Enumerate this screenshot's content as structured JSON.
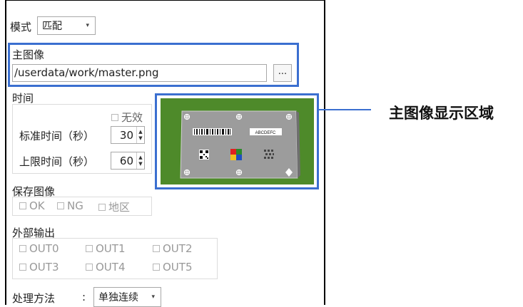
{
  "mode": {
    "label": "模式",
    "value": "匹配"
  },
  "master_image": {
    "label": "主图像",
    "path": "/userdata/work/master.png",
    "browse_label": "..."
  },
  "time": {
    "label": "时间",
    "none_label": "无效",
    "standard_label": "标准时间（秒）",
    "standard_value": "30",
    "limit_label": "上限时间（秒）",
    "limit_value": "60"
  },
  "save_image": {
    "label": "保存图像",
    "options": [
      "OK",
      "NG",
      "地区"
    ]
  },
  "external_output": {
    "label": "外部输出",
    "options": [
      "OUT0",
      "OUT1",
      "OUT2",
      "OUT3",
      "OUT4",
      "OUT5"
    ]
  },
  "process": {
    "label": "处理方法",
    "separator": ":",
    "value": "单独连续"
  },
  "preview": {
    "label_text": "ABCDEFC"
  },
  "annotation": {
    "text": "主图像显示区域"
  },
  "colors": {
    "callout": "#3b6fd0",
    "preview_bg": "#4e8a2a",
    "card": "#9c9c9c"
  }
}
